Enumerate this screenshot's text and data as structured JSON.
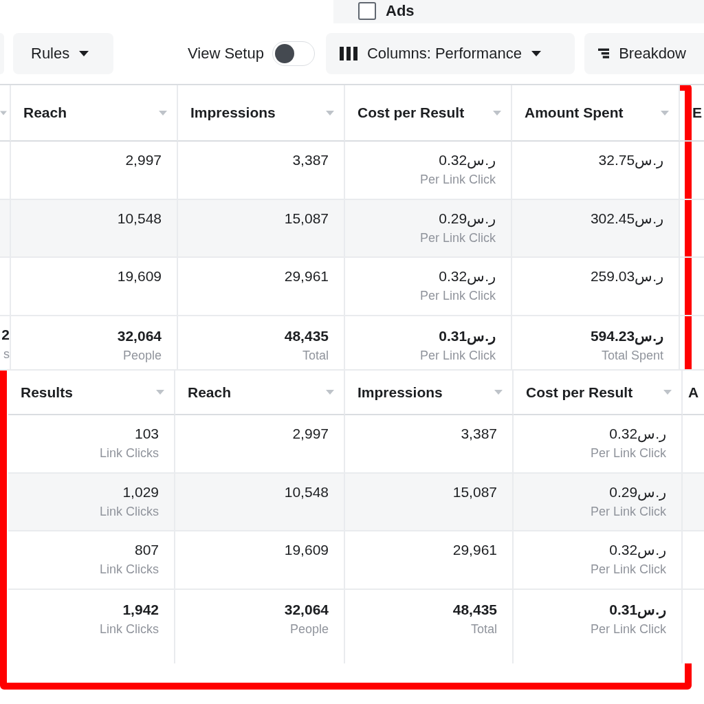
{
  "filter_panel": {
    "checkbox": {
      "label": "Ads",
      "checked": false
    }
  },
  "toolbar": {
    "rules_button": "Rules",
    "view_setup": {
      "label": "View Setup",
      "on": false
    },
    "columns_button": "Columns: Performance",
    "breakdown_button": "Breakdow"
  },
  "tables": [
    {
      "columns": [
        {},
        {
          "label": "Reach"
        },
        {
          "label": "Impressions"
        },
        {
          "label": "Cost per Result"
        },
        {
          "label": "Amount Spent"
        },
        {
          "label": "E"
        }
      ],
      "rows": [
        {
          "cells": [
            null,
            {
              "value": "2,997"
            },
            {
              "value": "3,387"
            },
            {
              "value": "0.32ر.س",
              "sub": "Per Link Click"
            },
            {
              "value": "32.75ر.س"
            },
            null
          ]
        },
        {
          "cells": [
            null,
            {
              "value": "10,548"
            },
            {
              "value": "15,087"
            },
            {
              "value": "0.29ر.س",
              "sub": "Per Link Click"
            },
            {
              "value": "302.45ر.س"
            },
            null
          ]
        },
        {
          "cells": [
            null,
            {
              "value": "19,609"
            },
            {
              "value": "29,961"
            },
            {
              "value": "0.32ر.س",
              "sub": "Per Link Click"
            },
            {
              "value": "259.03ر.س"
            },
            null
          ]
        }
      ],
      "totals": [
        {
          "value": "2",
          "sub": "s"
        },
        {
          "value": "32,064",
          "sub": "People"
        },
        {
          "value": "48,435",
          "sub": "Total"
        },
        {
          "value": "0.31ر.س",
          "sub": "Per Link Click"
        },
        {
          "value": "594.23ر.س",
          "sub": "Total Spent"
        }
      ]
    },
    {
      "columns": [
        {
          "label": "Results"
        },
        {
          "label": "Reach"
        },
        {
          "label": "Impressions"
        },
        {
          "label": "Cost per Result"
        },
        {
          "label": "A"
        }
      ],
      "rows": [
        {
          "cells": [
            {
              "value": "103",
              "sub": "Link Clicks"
            },
            {
              "value": "2,997"
            },
            {
              "value": "3,387"
            },
            {
              "value": "0.32ر.س",
              "sub": "Per Link Click"
            },
            null
          ]
        },
        {
          "cells": [
            {
              "value": "1,029",
              "sub": "Link Clicks"
            },
            {
              "value": "10,548"
            },
            {
              "value": "15,087"
            },
            {
              "value": "0.29ر.س",
              "sub": "Per Link Click"
            },
            null
          ]
        },
        {
          "cells": [
            {
              "value": "807",
              "sub": "Link Clicks"
            },
            {
              "value": "19,609"
            },
            {
              "value": "29,961"
            },
            {
              "value": "0.32ر.س",
              "sub": "Per Link Click"
            },
            null
          ]
        }
      ],
      "totals": [
        {
          "value": "1,942",
          "sub": "Link Clicks"
        },
        {
          "value": "32,064",
          "sub": "People"
        },
        {
          "value": "48,435",
          "sub": "Total"
        },
        {
          "value": "0.31ر.س",
          "sub": "Per Link Click"
        }
      ]
    }
  ]
}
